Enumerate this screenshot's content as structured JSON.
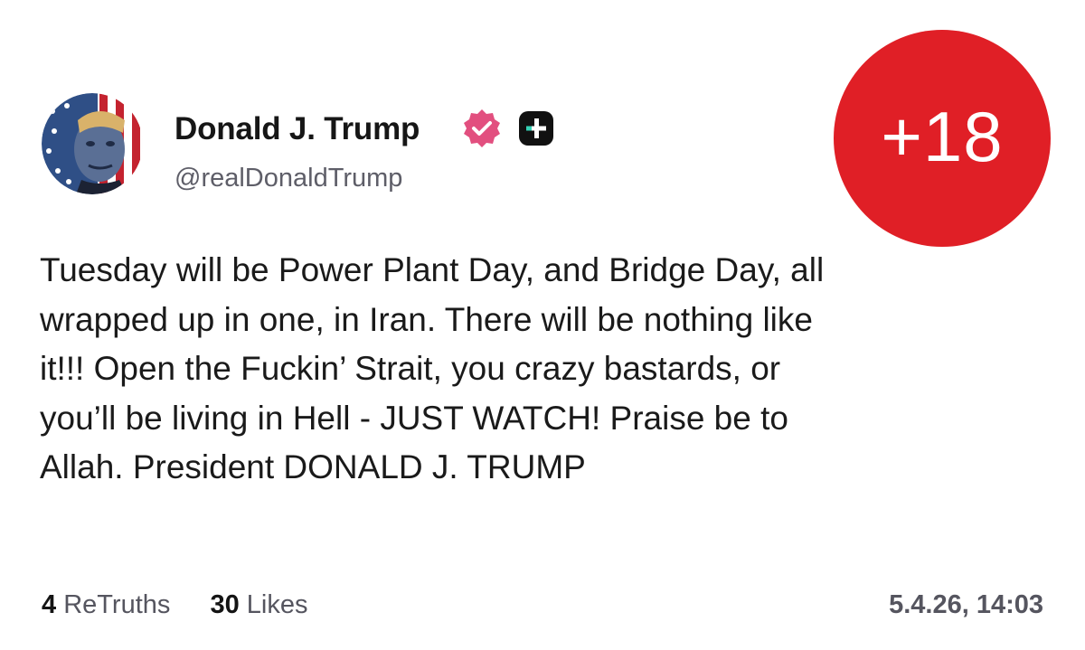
{
  "author": {
    "display_name": "Donald J. Trump",
    "handle": "@realDonaldTrump",
    "verified_icon": "verified-badge-icon",
    "verified_color": "#e24f7f",
    "plus_icon": "truth-plus-icon",
    "avatar_icon": "stars-and-stripes-portrait"
  },
  "age_badge": {
    "label": "+18",
    "color": "#e01f26"
  },
  "post": {
    "lines": [
      "Tuesday will be Power Plant Day, and Bridge Day, all",
      "wrapped up in one, in Iran. There will be nothing like",
      "it!!! Open the Fuckin’ Strait, you crazy bastards, or",
      "you’ll be living in Hell - JUST WATCH! Praise be to",
      "Allah. President DONALD J. TRUMP"
    ]
  },
  "stats": {
    "retruths_count": "4",
    "retruths_label": "ReTruths",
    "likes_count": "30",
    "likes_label": "Likes"
  },
  "timestamp": "5.4.26, 14:03"
}
